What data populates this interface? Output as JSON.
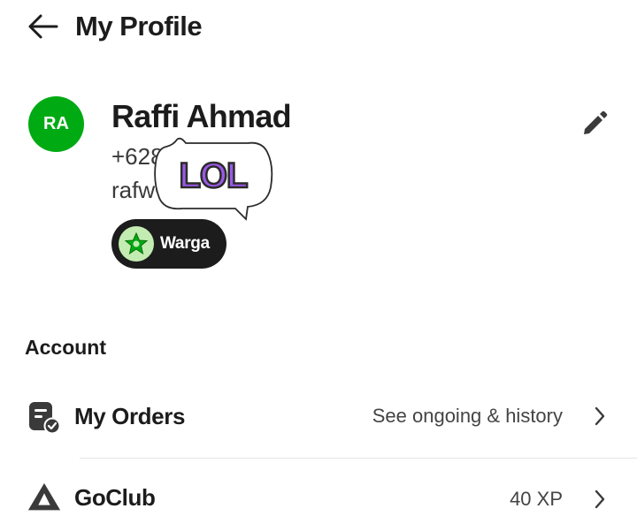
{
  "header": {
    "title": "My Profile"
  },
  "profile": {
    "initials": "RA",
    "name": "Raffi Ahmad",
    "phone": "+628••••••05 5",
    "email": "rafw••••••l.com",
    "badge": "Warga",
    "avatar_color": "#00aa13"
  },
  "sticker": {
    "text": "LOL"
  },
  "account": {
    "title": "Account",
    "items": [
      {
        "label": "My Orders",
        "detail": "See ongoing & history",
        "icon": "orders-icon"
      },
      {
        "label": "GoClub",
        "detail": "40 XP",
        "icon": "goclub-icon"
      }
    ]
  }
}
